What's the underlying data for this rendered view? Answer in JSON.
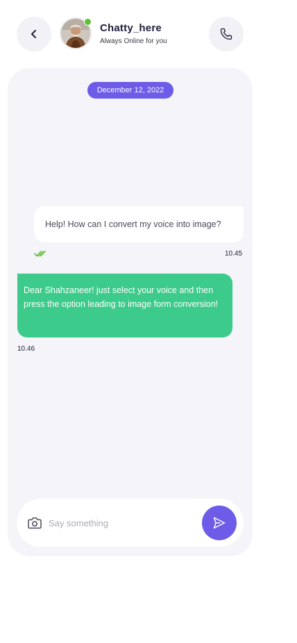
{
  "header": {
    "contact_name": "Chatty_here",
    "contact_status": "Always Online for you",
    "back_icon": "chevron-left-icon",
    "call_icon": "phone-icon",
    "online_color": "#5bc236"
  },
  "chat": {
    "date_label": "December 12, 2022",
    "messages": [
      {
        "direction": "outgoing",
        "text": "Help! How can I convert my voice into image?",
        "time": "10.45",
        "status_icon": "double-check-icon"
      },
      {
        "direction": "incoming",
        "text": "Dear Shahzaneer! just select your voice and then press the option leading to image form conversion!",
        "time": "10.46"
      }
    ]
  },
  "composer": {
    "placeholder": "Say something",
    "value": "",
    "camera_icon": "camera-icon",
    "send_icon": "send-icon"
  },
  "colors": {
    "accent": "#6c5ce7",
    "incoming_bubble": "#3ccb8a",
    "panel_bg": "#f4f4f9",
    "read_ticks": "#5bc236"
  }
}
